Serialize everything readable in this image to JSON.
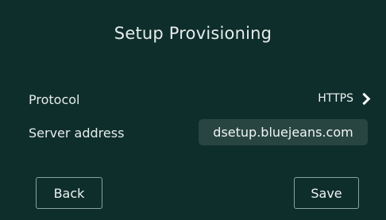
{
  "header": {
    "title": "Setup Provisioning"
  },
  "protocol": {
    "label": "Protocol",
    "value": "HTTPS",
    "icon": "chevron-right-icon"
  },
  "server": {
    "label": "Server address",
    "value": "dsetup.bluejeans.com"
  },
  "buttons": {
    "back_label": "Back",
    "save_label": "Save"
  },
  "colors": {
    "background": "#0e2e2b",
    "field": "#284541",
    "text": "#e6eceb",
    "button_border": "#8aa29e"
  }
}
